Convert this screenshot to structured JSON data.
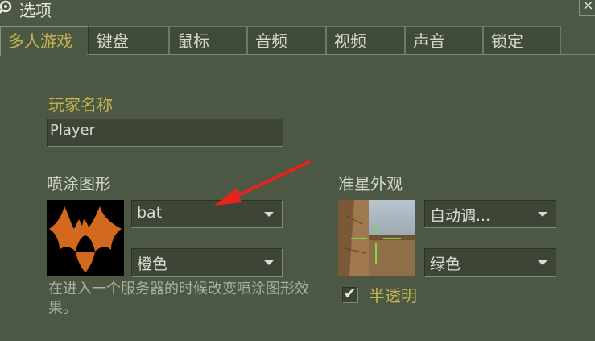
{
  "window": {
    "title": "选项",
    "icon": "steam-icon",
    "close_label": "×"
  },
  "tabs": [
    {
      "label": "多人游戏",
      "active": true
    },
    {
      "label": "键盘",
      "active": false
    },
    {
      "label": "鼠标",
      "active": false
    },
    {
      "label": "音频",
      "active": false
    },
    {
      "label": "视频",
      "active": false
    },
    {
      "label": "声音",
      "active": false
    },
    {
      "label": "锁定",
      "active": false
    }
  ],
  "player_name": {
    "label": "玩家名称",
    "value": "Player"
  },
  "spray": {
    "label": "喷涂图形",
    "preview_icon": "bat-icon",
    "preview_color": "#d2691e",
    "image_value": "bat",
    "color_value": "橙色",
    "hint": "在进入一个服务器的时候改变喷涂图形效果。"
  },
  "crosshair": {
    "label": "准星外观",
    "preview_icon": "crosshair-preview",
    "crosshair_color": "#7bd94a",
    "size_value": "自动调...",
    "color_value": "绿色",
    "translucent_label": "半透明",
    "translucent_checked": true
  },
  "annotation": {
    "arrow_color": "#e8221c"
  }
}
